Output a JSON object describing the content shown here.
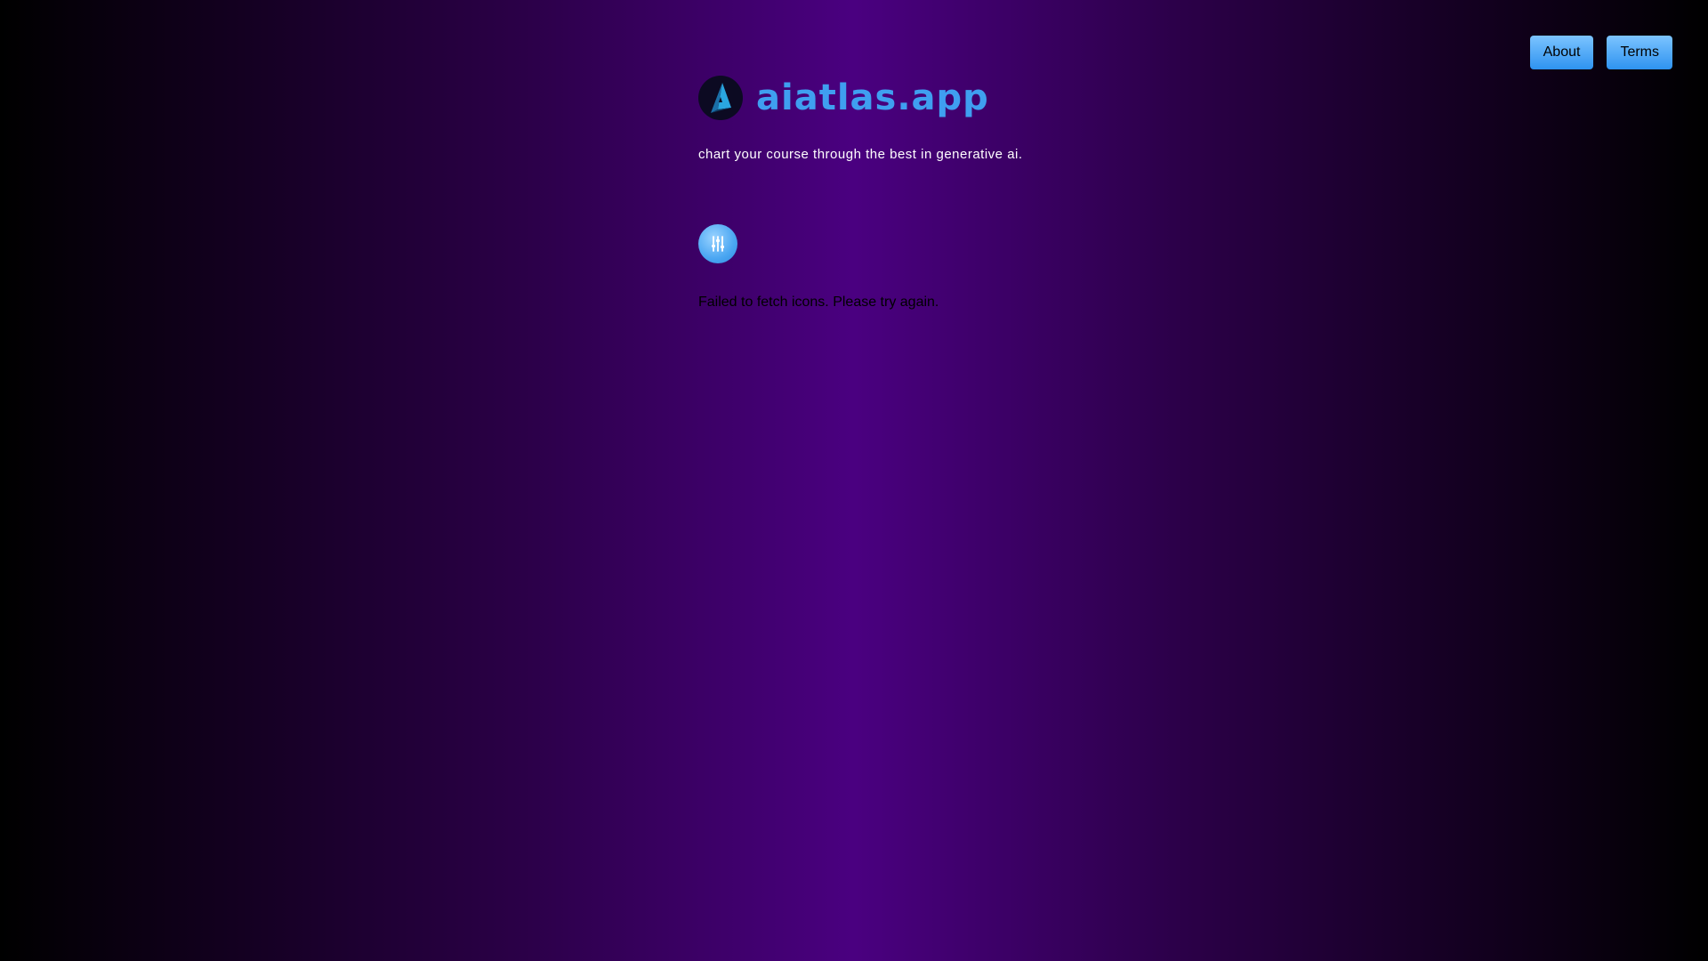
{
  "nav": {
    "about_label": "About",
    "terms_label": "Terms"
  },
  "brand": {
    "title": "aiatlas.app",
    "tagline": "chart your course through the best in generative ai.",
    "logo_icon": "compass-arrow-icon"
  },
  "filter": {
    "icon": "sliders-icon"
  },
  "status": {
    "error_message": "Failed to fetch icons. Please try again."
  },
  "colors": {
    "background_center": "#4a0080",
    "background_edge": "#000000",
    "accent": "#3f9ff0",
    "button_gradient_top": "#7cc4ff",
    "button_gradient_bottom": "#2e93f0"
  }
}
